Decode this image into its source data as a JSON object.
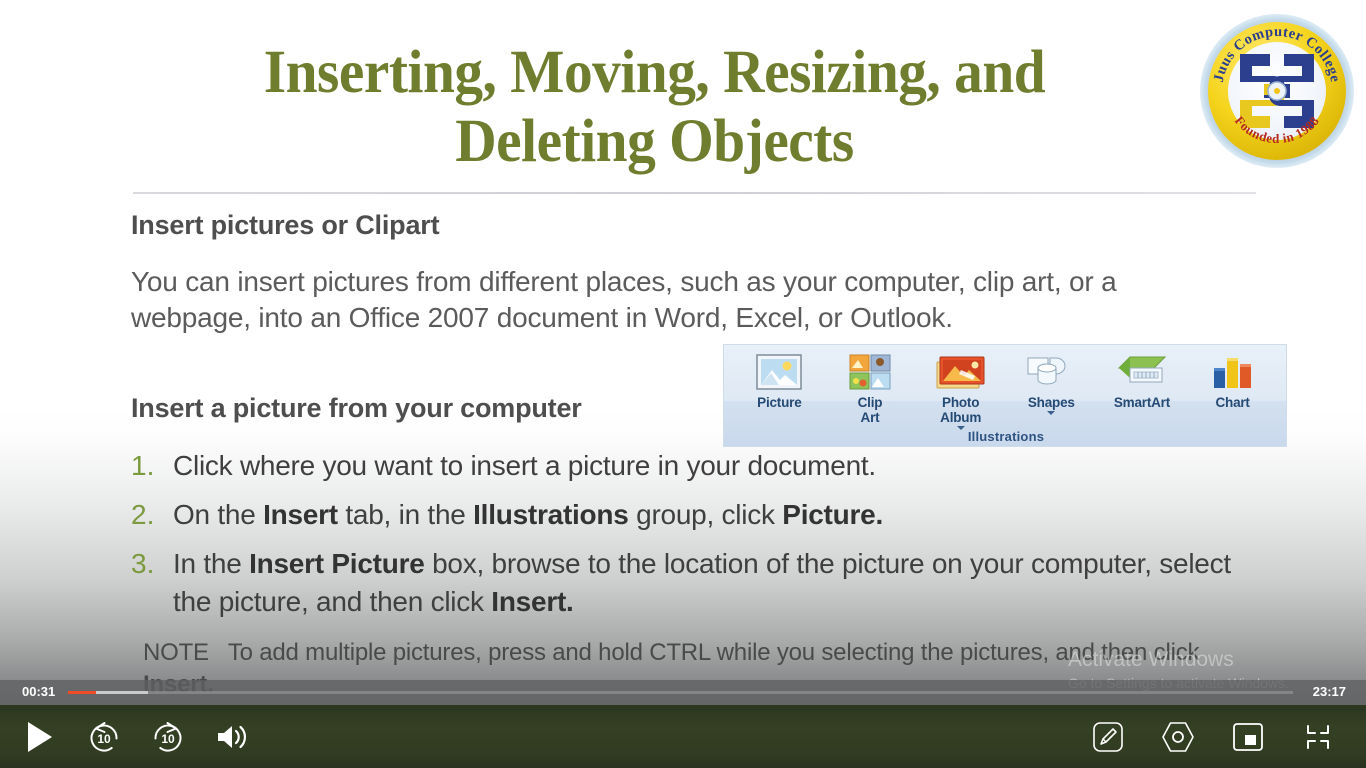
{
  "slide": {
    "title_lines": [
      "Inserting, Moving, Resizing, and",
      "Deleting Objects"
    ],
    "heading_pictures": "Insert pictures or Clipart",
    "paragraph_intro": "You can insert pictures from different places, such as your computer, clip art, or a webpage, into an Office 2007 document in Word, Excel, or Outlook.",
    "heading_from_computer": "Insert a picture from your computer",
    "steps": [
      {
        "number": "1.",
        "text": "Click where you want to insert a picture in your document."
      },
      {
        "number": "2.",
        "text": "On the Insert tab, in the Illustrations group, click Picture."
      },
      {
        "number": "3.",
        "text": "In the Insert Picture box, browse to the location of the picture on your computer, select the picture, and then click Insert."
      }
    ],
    "note": "NOTE   To add multiple pictures, press and hold CTRL while you selecting the pictures, and then click Insert.",
    "title_color": "#6f7d2e",
    "number_color": "#7c9a3e"
  },
  "ribbon": {
    "group_label": "Illustrations",
    "buttons": [
      {
        "label_line1": "Picture",
        "label_line2": "",
        "icon": "picture-icon",
        "has_caret": false
      },
      {
        "label_line1": "Clip",
        "label_line2": "Art",
        "icon": "clip-art-icon",
        "has_caret": false
      },
      {
        "label_line1": "Photo",
        "label_line2": "Album",
        "icon": "photo-album-icon",
        "has_caret": true
      },
      {
        "label_line1": "Shapes",
        "label_line2": "",
        "icon": "shapes-icon",
        "has_caret": true
      },
      {
        "label_line1": "SmartArt",
        "label_line2": "",
        "icon": "smartart-icon",
        "has_caret": false
      },
      {
        "label_line1": "Chart",
        "label_line2": "",
        "icon": "chart-icon",
        "has_caret": false
      }
    ]
  },
  "logo": {
    "top_text": "Juus Computer College",
    "bottom_text": "Founded in 1988",
    "ring_color": "#f5d41c"
  },
  "watermark": {
    "title": "Activate Windows",
    "subtitle": "Go to Settings to activate Windows."
  },
  "player": {
    "time_current": "00:31",
    "time_total": "23:17",
    "played_percent": 2.3,
    "buffered_percent": 6.5,
    "accent_color": "#ef4b25",
    "controls_left": [
      {
        "name": "play-button",
        "label": "Play"
      },
      {
        "name": "rewind-10-button",
        "label": "10"
      },
      {
        "name": "forward-10-button",
        "label": "10"
      },
      {
        "name": "volume-button",
        "label": "Volume"
      }
    ],
    "controls_right": [
      {
        "name": "annotate-button",
        "label": "Annotate"
      },
      {
        "name": "record-button",
        "label": "Record"
      },
      {
        "name": "picture-in-picture-button",
        "label": "Picture in picture"
      },
      {
        "name": "exit-fullscreen-button",
        "label": "Exit full screen"
      }
    ]
  }
}
